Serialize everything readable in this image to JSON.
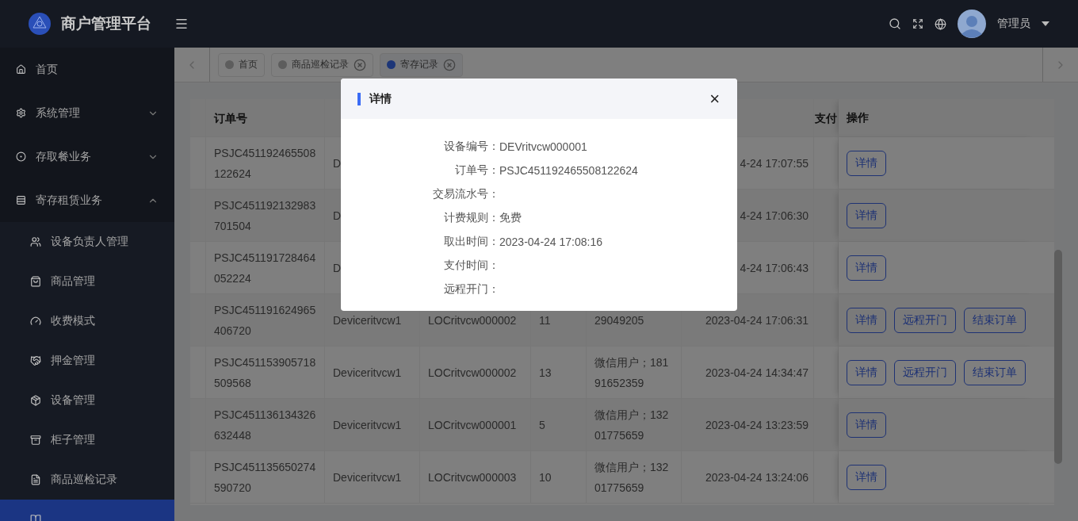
{
  "header": {
    "title": "商户管理平台",
    "user": "管理员"
  },
  "sidebar": {
    "items": [
      {
        "label": "首页",
        "selected": false
      },
      {
        "label": "系统管理",
        "selected": false,
        "expanded": false
      },
      {
        "label": "存取餐业务",
        "selected": false,
        "expanded": false
      },
      {
        "label": "寄存租赁业务",
        "selected": false,
        "expanded": true,
        "children": [
          {
            "label": "设备负责人管理",
            "selected": false
          },
          {
            "label": "商品管理",
            "selected": false
          },
          {
            "label": "收费模式",
            "selected": false
          },
          {
            "label": "押金管理",
            "selected": false
          },
          {
            "label": "设备管理",
            "selected": false
          },
          {
            "label": "柜子管理",
            "selected": false
          },
          {
            "label": "商品巡检记录",
            "selected": false
          },
          {
            "selected": true
          }
        ]
      }
    ]
  },
  "tabs": [
    {
      "label": "首页",
      "selected": false,
      "closable": false
    },
    {
      "label": "商品巡检记录",
      "selected": false,
      "closable": true
    },
    {
      "label": "寄存记录",
      "selected": true,
      "closable": true
    }
  ],
  "table": {
    "columns": [
      "订单号",
      "支付"
    ],
    "action_column": "操作",
    "rows": [
      {
        "order": "PSJC451192465508122624",
        "device": "D",
        "time": "4-24 17:07:55",
        "actions": [
          "详情"
        ]
      },
      {
        "order": "PSJC451192132983701504",
        "device": "D",
        "time": "4-24 17:06:30",
        "actions": [
          "详情"
        ]
      },
      {
        "order": "PSJC451191728464052224",
        "device": "D",
        "time": "4-24 17:06:43",
        "actions": [
          "详情"
        ]
      },
      {
        "order": "PSJC451191624965406720",
        "device": "Deviceritvcw1",
        "locker": "LOCritvcw000002",
        "qty": "11",
        "user": "29049205",
        "time": "2023-04-24 17:06:31",
        "actions": [
          "详情",
          "远程开门",
          "结束订单"
        ]
      },
      {
        "order": "PSJC451153905718509568",
        "device": "Deviceritvcw1",
        "locker": "LOCritvcw000002",
        "qty": "13",
        "user": "微信用户；18191652359",
        "time": "2023-04-24 14:34:47",
        "actions": [
          "详情",
          "远程开门",
          "结束订单"
        ]
      },
      {
        "order": "PSJC451136134326632448",
        "device": "Deviceritvcw1",
        "locker": "LOCritvcw000001",
        "qty": "5",
        "user": "微信用户；13201775659",
        "time": "2023-04-24 13:23:59",
        "actions": [
          "详情"
        ]
      },
      {
        "order": "PSJC451135650274590720",
        "device": "Deviceritvcw1",
        "locker": "LOCritvcw000003",
        "qty": "10",
        "user": "微信用户；13201775659",
        "time": "2023-04-24 13:24:06",
        "actions": [
          "详情"
        ]
      }
    ]
  },
  "dialog": {
    "title": "详情",
    "close": "×",
    "fields": [
      {
        "label": "设备编号：",
        "value": "DEVritvcw000001"
      },
      {
        "label": "订单号：",
        "value": "PSJC451192465508122624"
      },
      {
        "label": "交易流水号："
      },
      {
        "label": "计费规则：",
        "value": "免费"
      },
      {
        "label": "取出时间：",
        "value": "2023-04-24 17:08:16"
      },
      {
        "label": "支付时间："
      },
      {
        "label": "远程开门："
      }
    ]
  }
}
